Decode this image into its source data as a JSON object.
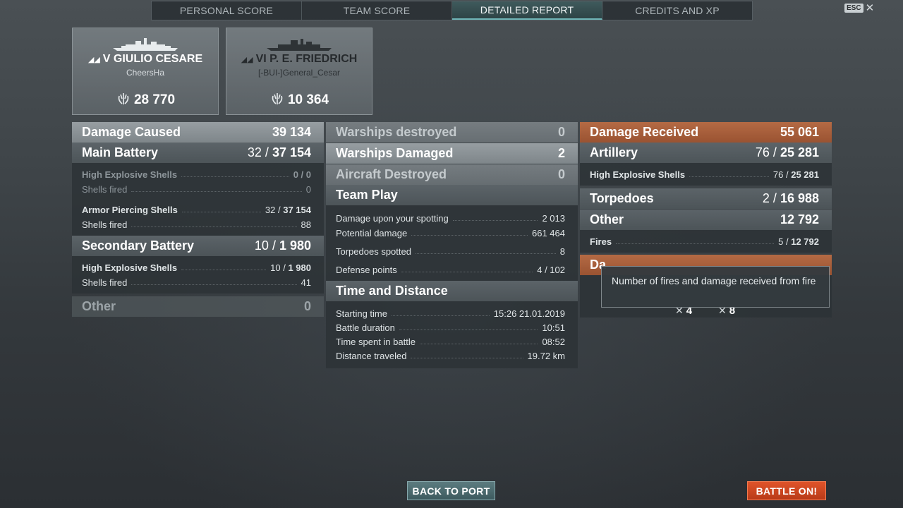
{
  "tabs": [
    {
      "label": "PERSONAL SCORE"
    },
    {
      "label": "TEAM SCORE"
    },
    {
      "label": "DETAILED REPORT"
    },
    {
      "label": "CREDITS AND XP"
    }
  ],
  "esc": {
    "key": "ESC",
    "close": "✕"
  },
  "ships": [
    {
      "tier": "V",
      "name": "GIULIO CESARE",
      "player": "CheersHa",
      "score": "28 770"
    },
    {
      "tier": "VI",
      "name": "P. E. FRIEDRICH",
      "player": "[-BUI-]General_Cesar",
      "score": "10 364"
    }
  ],
  "damage_caused": {
    "title": "Damage Caused",
    "total": "39 134",
    "main_battery": {
      "label": "Main Battery",
      "hits": "32",
      "damage": "37 154"
    },
    "mb_he": {
      "label": "High Explosive Shells",
      "hits": "0",
      "damage": "0"
    },
    "mb_he_fired": {
      "label": "Shells fired",
      "value": "0"
    },
    "mb_ap": {
      "label": "Armor Piercing Shells",
      "hits": "32",
      "damage": "37 154"
    },
    "mb_ap_fired": {
      "label": "Shells fired",
      "value": "88"
    },
    "secondary": {
      "label": "Secondary Battery",
      "hits": "10",
      "damage": "1 980"
    },
    "sec_he": {
      "label": "High Explosive Shells",
      "hits": "10",
      "damage": "1 980"
    },
    "sec_he_fired": {
      "label": "Shells fired",
      "value": "41"
    },
    "other": {
      "label": "Other",
      "value": "0"
    }
  },
  "middle": {
    "warships_destroyed": {
      "label": "Warships destroyed",
      "value": "0"
    },
    "warships_damaged": {
      "label": "Warships Damaged",
      "value": "2"
    },
    "aircraft_destroyed": {
      "label": "Aircraft Destroyed",
      "value": "0"
    },
    "team_play": {
      "title": "Team Play",
      "rows": [
        {
          "label": "Damage upon your spotting",
          "value": "2 013"
        },
        {
          "label": "Potential damage",
          "value": "661 464"
        },
        {
          "label": "Torpedoes spotted",
          "value": "8"
        },
        {
          "label": "Defense points",
          "value": "4 / 102"
        }
      ]
    },
    "time_distance": {
      "title": "Time and Distance",
      "rows": [
        {
          "label": "Starting time",
          "value": "15:26  21.01.2019"
        },
        {
          "label": "Battle duration",
          "value": "10:51"
        },
        {
          "label": "Time spent in battle",
          "value": "08:52"
        },
        {
          "label": "Distance traveled",
          "value": "19.72 km"
        }
      ]
    }
  },
  "damage_received": {
    "title": "Damage Received",
    "total": "55 061",
    "artillery": {
      "label": "Artillery",
      "hits": "76",
      "damage": "25 281"
    },
    "art_he": {
      "label": "High Explosive Shells",
      "hits": "76",
      "damage": "25 281"
    },
    "torpedoes": {
      "label": "Torpedoes",
      "hits": "2",
      "damage": "16 988"
    },
    "other": {
      "label": "Other",
      "value": "12 792"
    },
    "fires": {
      "label": "Fires",
      "hits": "5",
      "damage": "12 792"
    },
    "blocked_label": "Da"
  },
  "tooltip": {
    "text": "Number of fires and damage received from fire"
  },
  "ribbons": [
    {
      "value": "4"
    },
    {
      "value": "8"
    }
  ],
  "buttons": {
    "back": "BACK TO PORT",
    "battle": "BATTLE ON!"
  }
}
